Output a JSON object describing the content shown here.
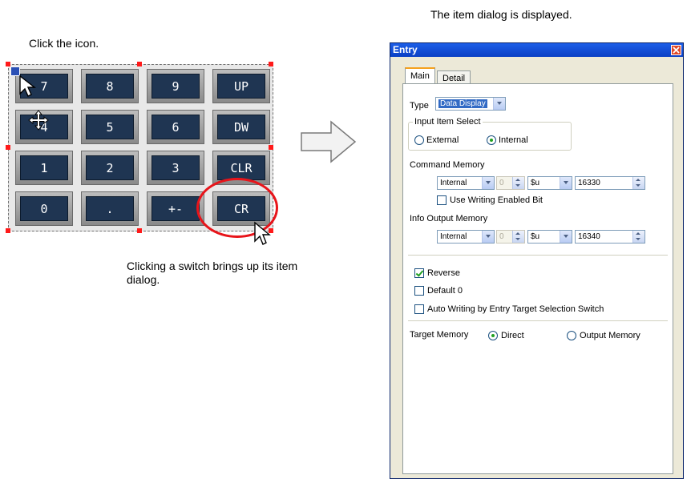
{
  "captions": {
    "click_icon": "Click the icon.",
    "dialog_displayed": "The item dialog is displayed.",
    "switch_note": "Clicking a switch brings up its item dialog."
  },
  "keypad": {
    "keys": [
      "7",
      "8",
      "9",
      "UP",
      "4",
      "5",
      "6",
      "DW",
      "1",
      "2",
      "3",
      "CLR",
      "0",
      ".",
      "+-",
      "CR"
    ]
  },
  "dialog": {
    "title": "Entry",
    "tabs": [
      "Main",
      "Detail"
    ],
    "type_label": "Type",
    "type_value": "Data Display",
    "input_item_select": {
      "legend": "Input Item Select",
      "external": "External",
      "internal": "Internal"
    },
    "command_memory": {
      "label": "Command Memory",
      "source": "Internal",
      "number": "0",
      "type": "$u",
      "address": "16330",
      "use_writing_enabled_bit": "Use Writing Enabled Bit"
    },
    "info_output_memory": {
      "label": "Info Output Memory",
      "source": "Internal",
      "number": "0",
      "type": "$u",
      "address": "16340"
    },
    "reverse": "Reverse",
    "default_zero": "Default 0",
    "auto_writing": "Auto Writing by Entry Target Selection Switch",
    "target_memory": {
      "label": "Target Memory",
      "direct": "Direct",
      "output_memory": "Output Memory"
    }
  },
  "colors": {
    "highlight_ring": "#e8141a",
    "title_bar": "#0a3fc4",
    "key_face": "#1f3552"
  },
  "icons": [
    "cursor-arrow-icon",
    "move-icon",
    "keypad-icon",
    "close-icon",
    "right-arrow-icon"
  ]
}
